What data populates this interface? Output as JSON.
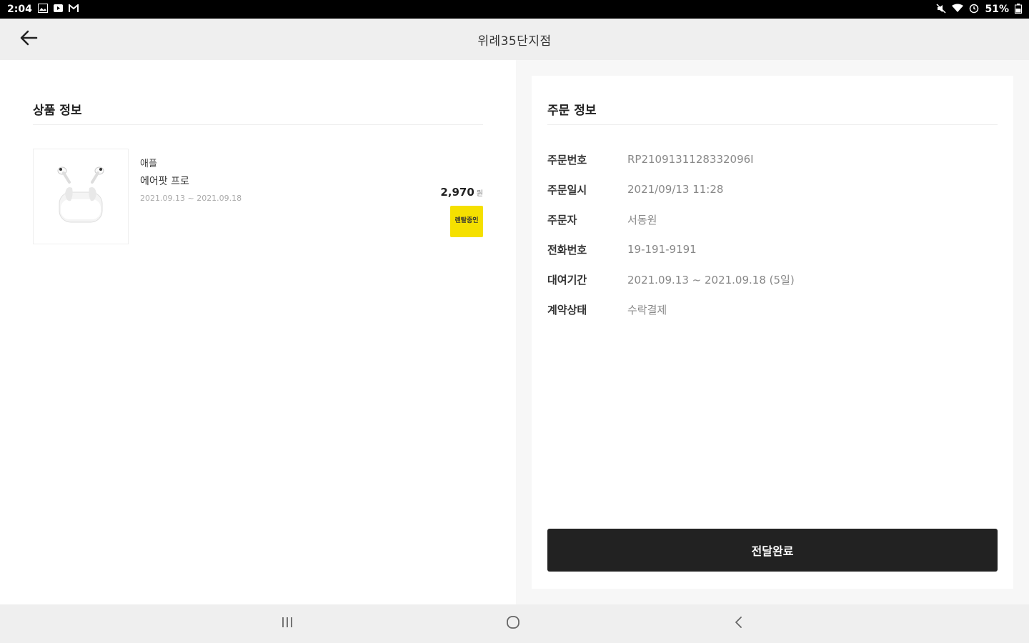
{
  "status_bar": {
    "time": "2:04",
    "left_icons": [
      "image-icon",
      "play-icon",
      "mail-icon"
    ],
    "battery": "51%",
    "right_icons": [
      "mute-icon",
      "wifi-icon",
      "alarm-icon",
      "battery-icon"
    ]
  },
  "header": {
    "title": "위례35단지점",
    "back_icon": "arrow-left-icon"
  },
  "product_section": {
    "title": "상품 정보",
    "product": {
      "image": "airpods-pro-image",
      "brand": "애플",
      "name": "에어팟 프로",
      "period": "2021.09.13 ~ 2021.09.18",
      "price": "2,970",
      "price_unit": "원",
      "badge_label": "렌탈중인"
    }
  },
  "order_section": {
    "title": "주문 정보",
    "rows": [
      {
        "label": "주문번호",
        "value": "RP2109131128332096I"
      },
      {
        "label": "주문일시",
        "value": "2021/09/13 11:28"
      },
      {
        "label": "주문자",
        "value": "서동원"
      },
      {
        "label": "전화번호",
        "value": "19-191-9191"
      },
      {
        "label": "대여기간",
        "value": "2021.09.13 ~ 2021.09.18 (5일)"
      },
      {
        "label": "계약상태",
        "value": "수락결제"
      }
    ],
    "confirm_button": "전달완료"
  },
  "nav_bar": {
    "icons": [
      "recents-icon",
      "home-icon",
      "back-icon"
    ]
  },
  "colors": {
    "accent_yellow": "#f5e000",
    "button_dark": "#222222",
    "appbar_bg": "#efefef"
  }
}
